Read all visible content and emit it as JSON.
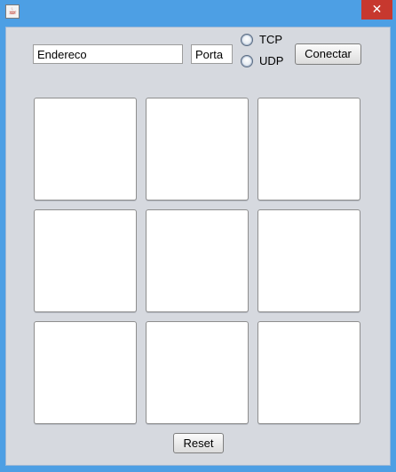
{
  "window": {
    "icon": "java-coffee-icon",
    "close_label": "✕"
  },
  "connection": {
    "address_value": "Endereco",
    "port_value": "Porta",
    "protocols": [
      {
        "label": "TCP",
        "selected": false
      },
      {
        "label": "UDP",
        "selected": false
      }
    ],
    "connect_label": "Conectar"
  },
  "board": {
    "rows": 3,
    "cols": 3,
    "cells": [
      "",
      "",
      "",
      "",
      "",
      "",
      "",
      "",
      ""
    ]
  },
  "footer": {
    "reset_label": "Reset"
  }
}
